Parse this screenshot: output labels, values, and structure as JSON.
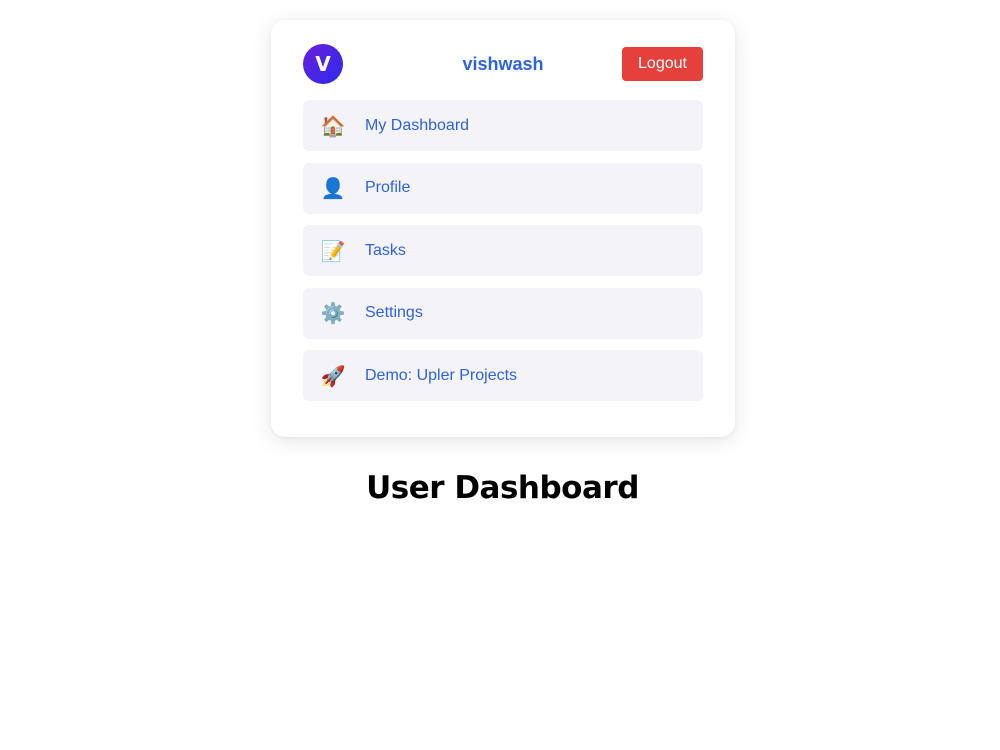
{
  "header": {
    "avatar_initial": "V",
    "username": "vishwash",
    "logout_label": "Logout"
  },
  "nav": {
    "items": [
      {
        "icon": "house-icon",
        "glyph": "🏠",
        "label": "My Dashboard"
      },
      {
        "icon": "user-icon",
        "glyph": "👤",
        "label": "Profile"
      },
      {
        "icon": "memo-icon",
        "glyph": "📝",
        "label": "Tasks"
      },
      {
        "icon": "gear-icon",
        "glyph": "⚙️",
        "label": "Settings"
      },
      {
        "icon": "rocket-icon",
        "glyph": "🚀",
        "label": "Demo: Upler Projects"
      }
    ]
  },
  "main": {
    "title": "User Dashboard"
  },
  "colors": {
    "accent": "#2f63d9",
    "logout": "#e5403b",
    "item_bg": "#f3f3f8",
    "avatar_gradient_start": "#6a1fd9",
    "avatar_gradient_end": "#2b2bf0"
  }
}
